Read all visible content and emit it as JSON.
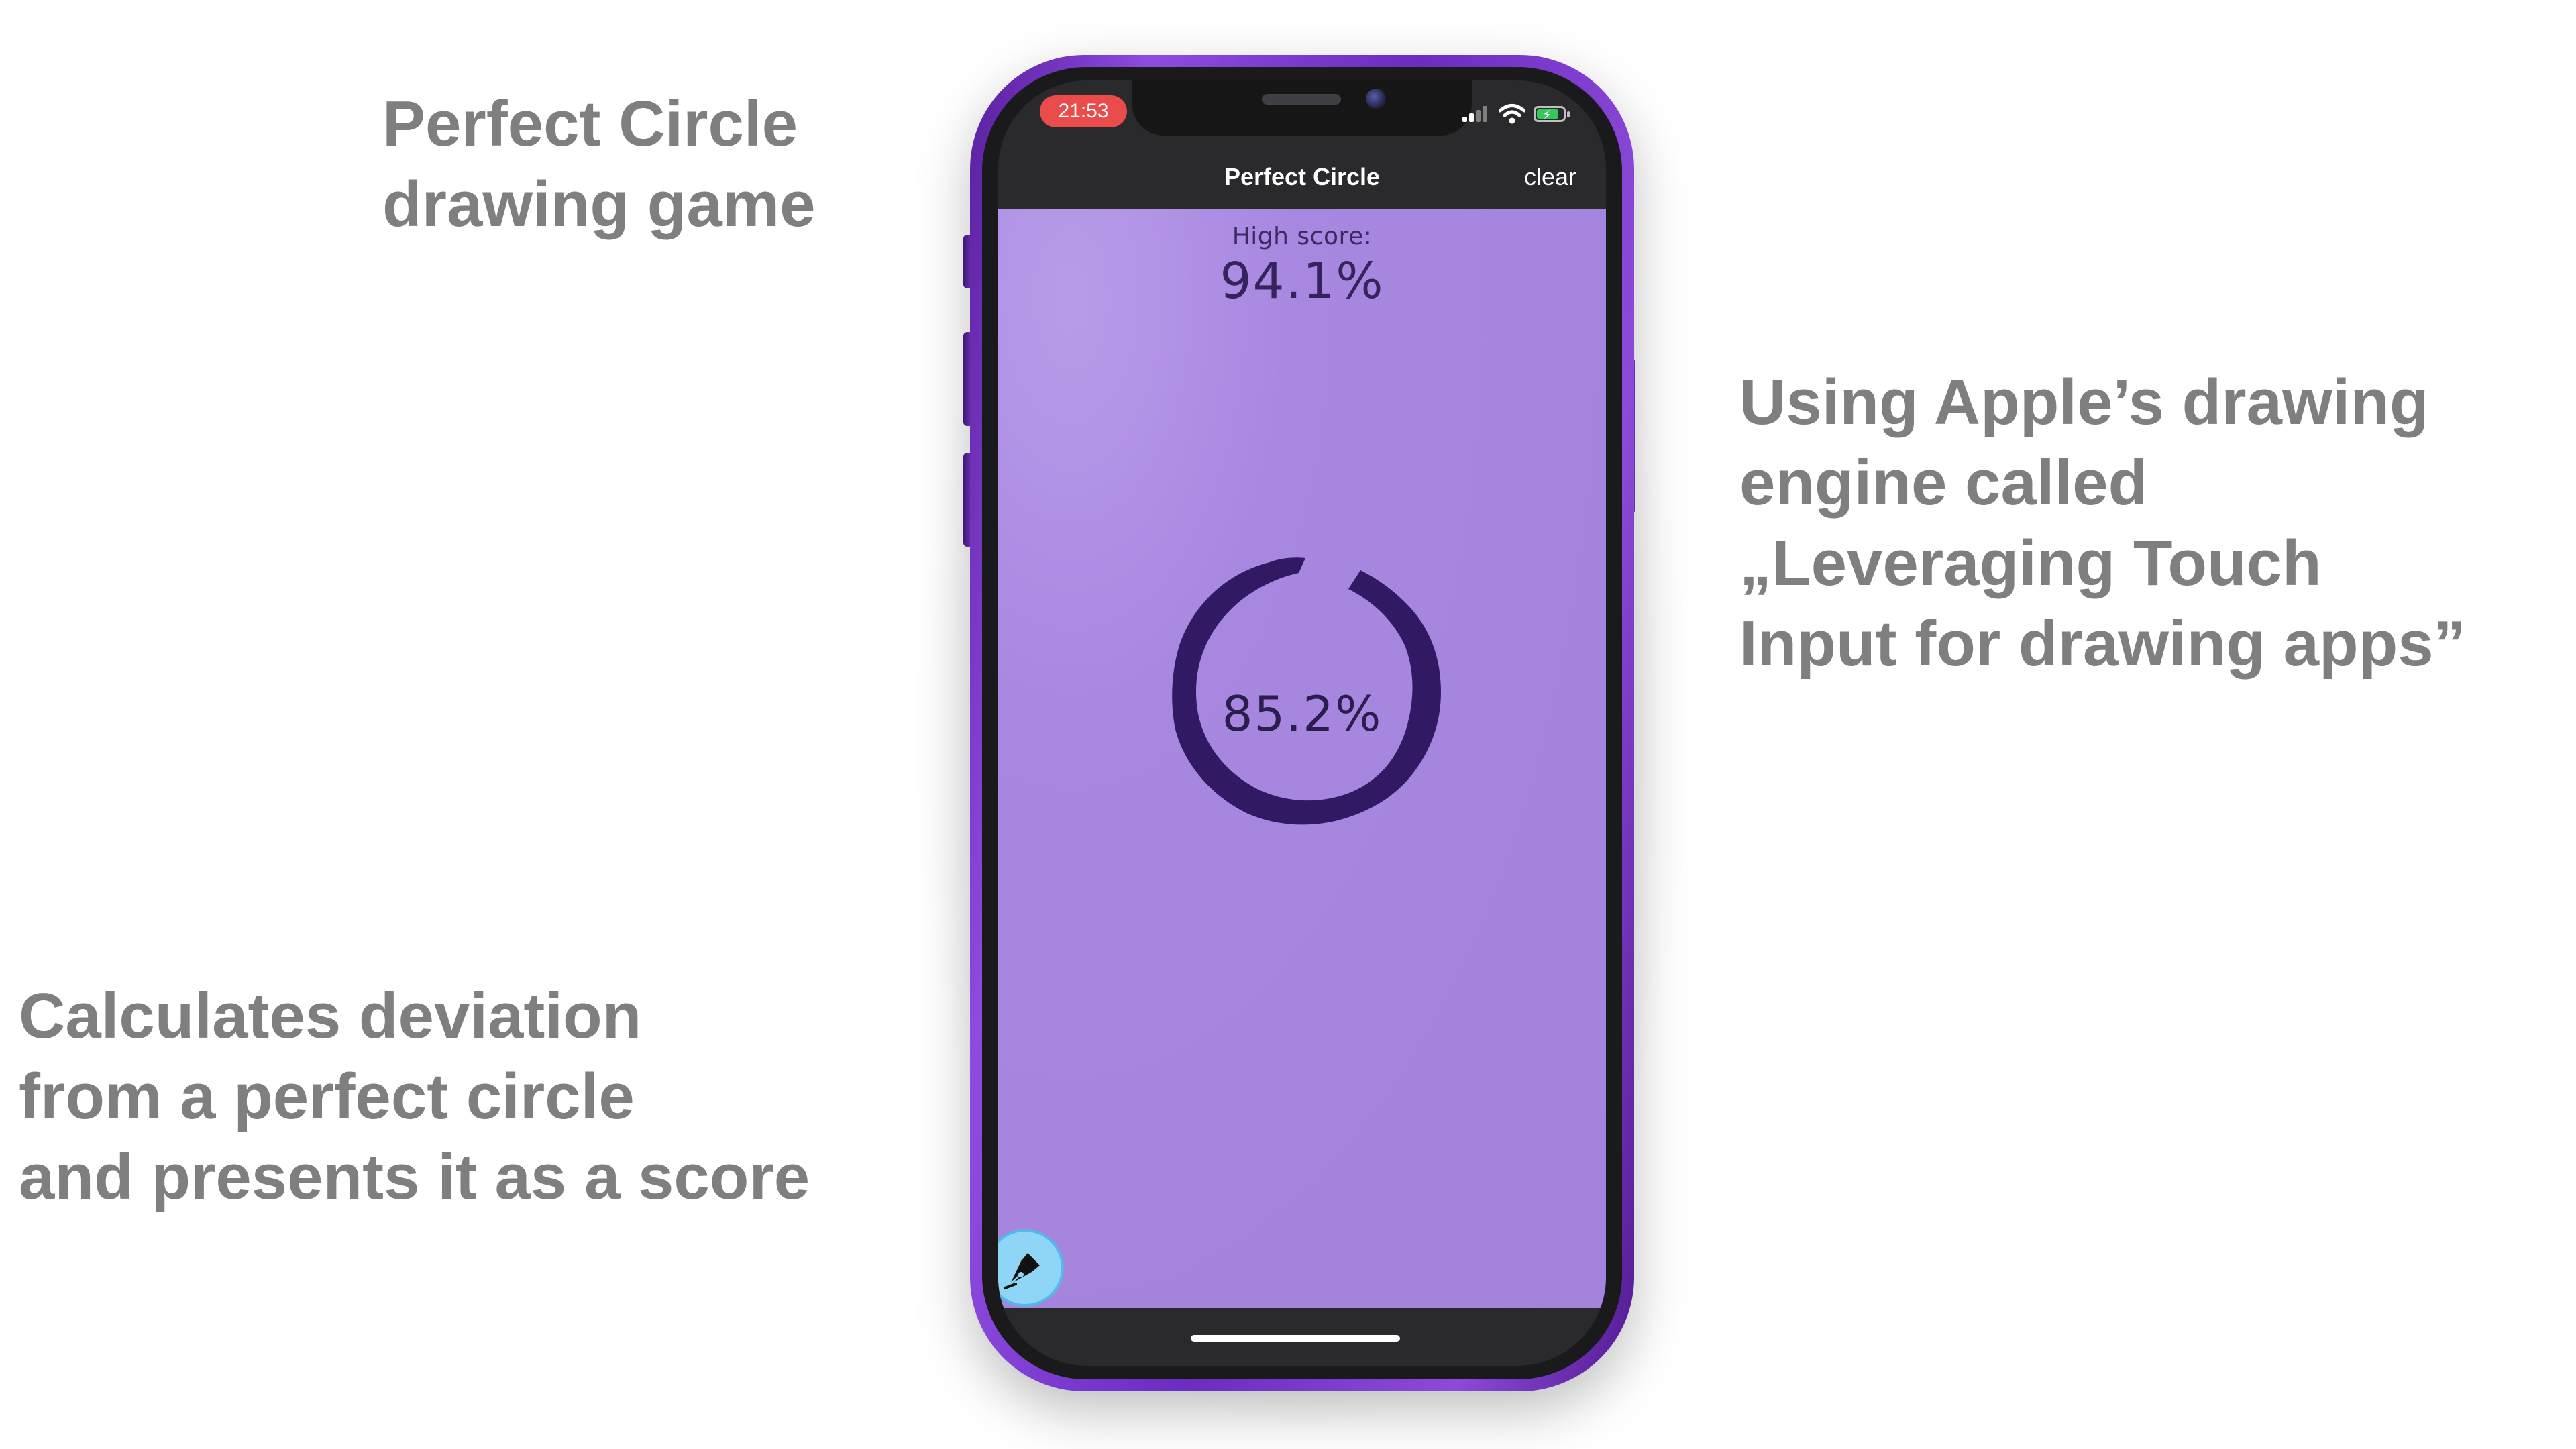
{
  "captions": {
    "title": [
      "Perfect Circle",
      "drawing game"
    ],
    "engine": [
      "Using Apple’s drawing",
      "engine called",
      "„Leveraging Touch",
      "Input for drawing apps”"
    ],
    "deviation": [
      "Calculates deviation",
      "from a perfect circle",
      "and presents it as a score"
    ]
  },
  "status_bar": {
    "time": "21:53",
    "icons": [
      "signal-icon",
      "wifi-icon",
      "battery-charging-icon"
    ],
    "time_badge_color": "#ea4c4c",
    "battery_color": "#34c759"
  },
  "nav_bar": {
    "title": "Perfect Circle",
    "clear_label": "clear"
  },
  "game": {
    "high_score_label": "High score:",
    "high_score_value": "94.1%",
    "score_value": "85.2%",
    "canvas_color": "#a585dd",
    "stroke_color": "#311a63",
    "tool_button_icon": "fountain-pen-icon",
    "tool_button_color": "#8fd5f5"
  },
  "colors": {
    "caption_text": "#7f7f7f",
    "phone_frame": "#7a3bd0"
  }
}
